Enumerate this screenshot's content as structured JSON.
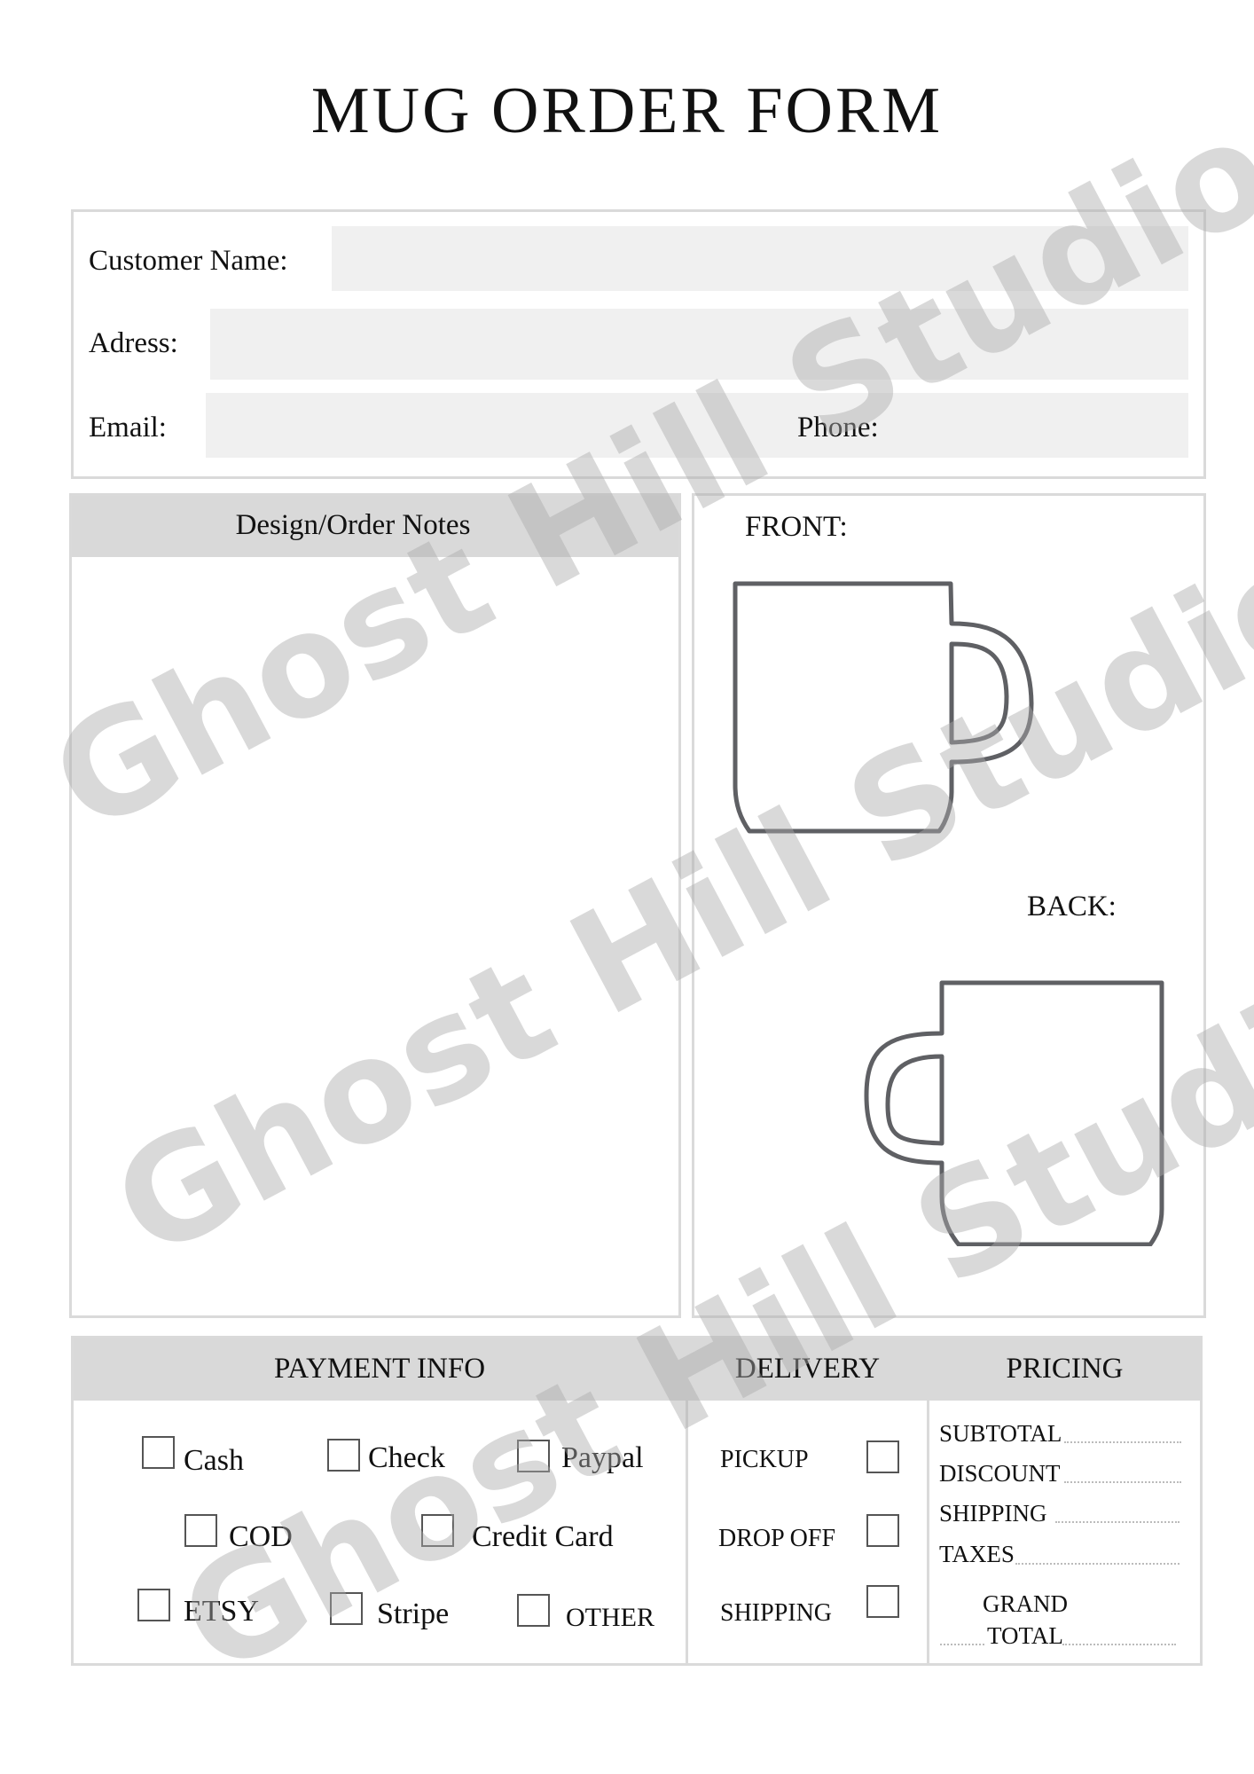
{
  "title": "MUG ORDER FORM",
  "customer": {
    "name_label": "Customer Name:",
    "name_value": "",
    "address_label": "Adress:",
    "address_value": "",
    "email_label": "Email:",
    "email_value": "",
    "phone_label": "Phone:",
    "phone_value": ""
  },
  "notes": {
    "header": "Design/Order Notes",
    "value": ""
  },
  "design": {
    "front_label": "FRONT:",
    "back_label": "BACK:",
    "front_icon": "mug-front-outline-icon",
    "back_icon": "mug-back-outline-icon"
  },
  "payment": {
    "header": "PAYMENT INFO",
    "options": [
      {
        "label": "Cash",
        "checked": false
      },
      {
        "label": "Check",
        "checked": false
      },
      {
        "label": "Paypal",
        "checked": false
      },
      {
        "label": "COD",
        "checked": false
      },
      {
        "label": "Credit Card",
        "checked": false
      },
      {
        "label": "ETSY",
        "checked": false
      },
      {
        "label": "Stripe",
        "checked": false
      },
      {
        "label": "OTHER",
        "checked": false
      }
    ]
  },
  "delivery": {
    "header": "DELIVERY",
    "options": [
      {
        "label": "PICKUP",
        "checked": false
      },
      {
        "label": "DROP OFF",
        "checked": false
      },
      {
        "label": "SHIPPING",
        "checked": false
      }
    ]
  },
  "pricing": {
    "header": "PRICING",
    "rows": [
      {
        "label": "SUBTOTAL",
        "value": ""
      },
      {
        "label": "DISCOUNT",
        "value": ""
      },
      {
        "label": "SHIPPING",
        "value": ""
      },
      {
        "label": "TAXES",
        "value": ""
      }
    ],
    "grand_total_line1": "GRAND",
    "grand_total_line2": "TOTAL",
    "grand_total_value": ""
  },
  "watermark": {
    "text": "Ghost Hill Studio",
    "color": "#aaaaaa"
  },
  "colors": {
    "header_bg": "#d9d9d9",
    "field_bg": "#f0f0f0",
    "border": "#dadada",
    "mug_stroke": "#5f6064"
  }
}
